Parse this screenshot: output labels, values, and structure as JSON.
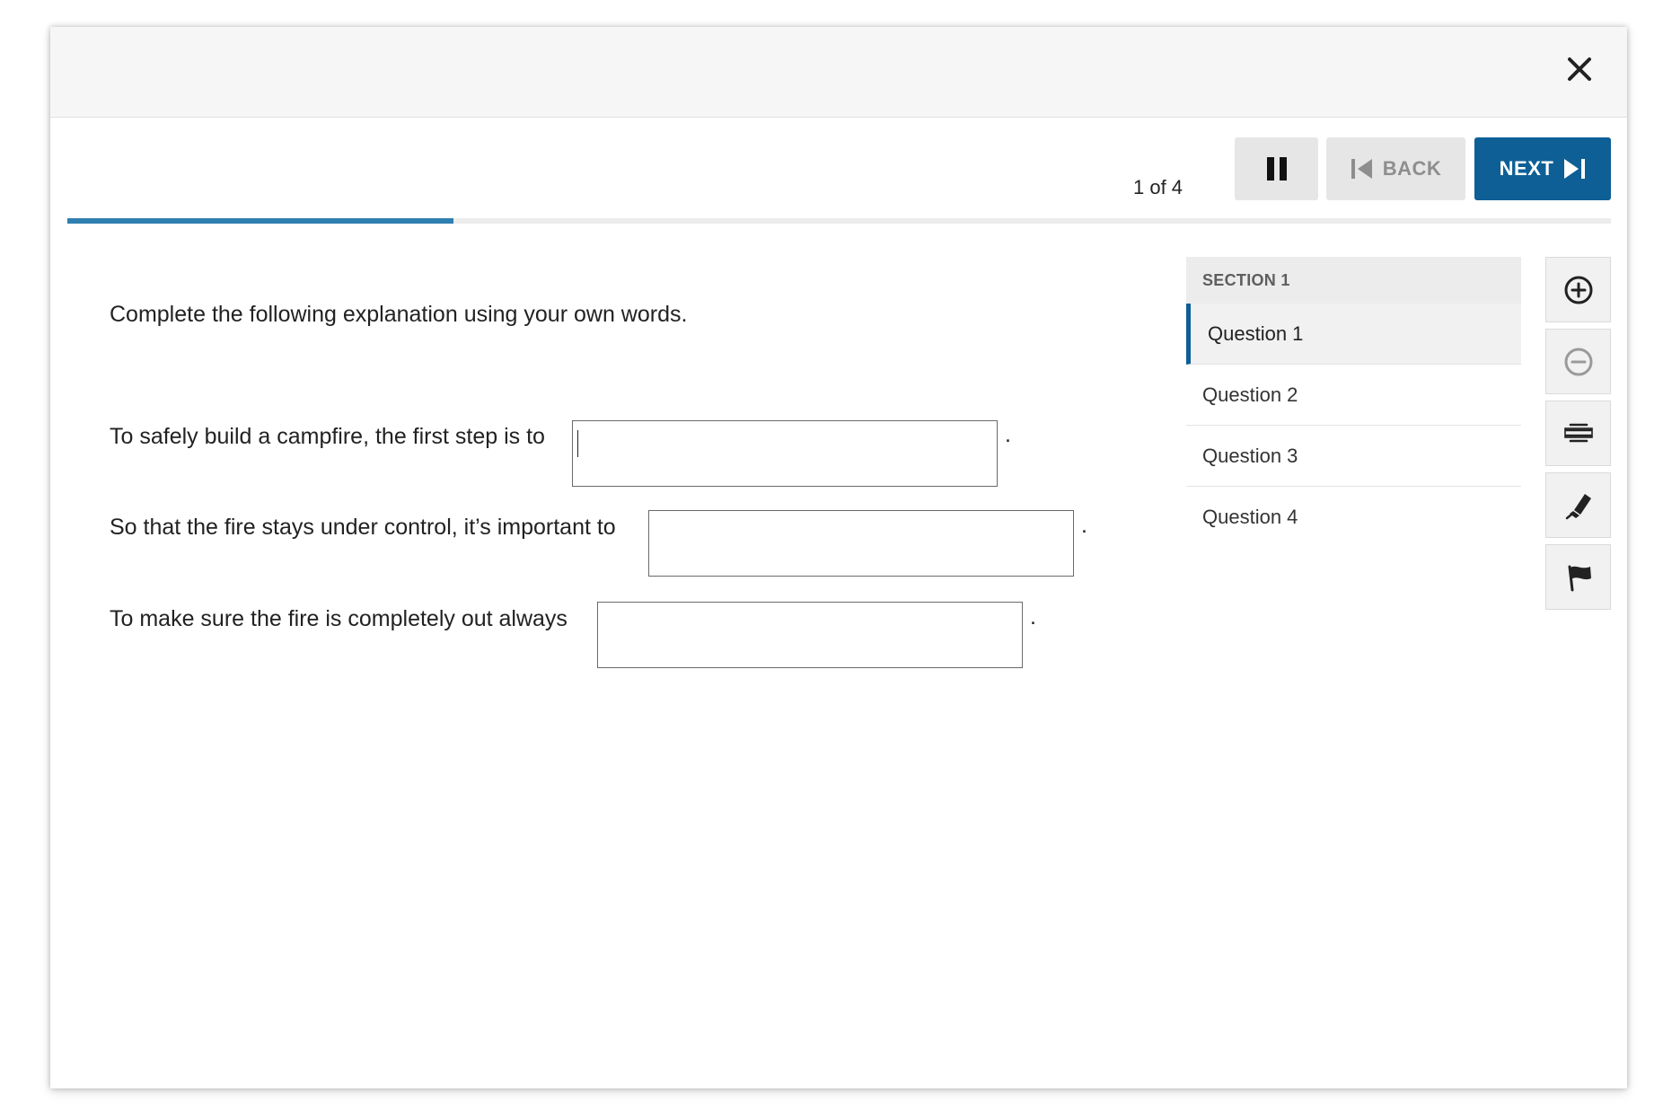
{
  "header": {
    "close_icon": "close-icon"
  },
  "toolbar": {
    "counter": "1 of 4",
    "pause_icon": "pause-icon",
    "back_label": "BACK",
    "next_label": "NEXT"
  },
  "progress": {
    "fraction": 0.25,
    "color": "#2f7fb0"
  },
  "question": {
    "prompt": "Complete the following explanation using your own words.",
    "sentences": [
      {
        "text": "To safely build a campfire, the first step is to",
        "value": "",
        "suffix": "."
      },
      {
        "text": "So that the fire stays under control, it’s important to",
        "value": "",
        "suffix": "."
      },
      {
        "text": "To make sure the fire is completely out always",
        "value": "",
        "suffix": "."
      }
    ]
  },
  "navigation": {
    "section_label": "SECTION 1",
    "items": [
      {
        "label": "Question 1",
        "active": true
      },
      {
        "label": "Question 2",
        "active": false
      },
      {
        "label": "Question 3",
        "active": false
      },
      {
        "label": "Question 4",
        "active": false
      }
    ]
  },
  "tools": [
    {
      "icon": "zoom-in-icon",
      "enabled": true
    },
    {
      "icon": "zoom-out-icon",
      "enabled": false
    },
    {
      "icon": "line-reader-icon",
      "enabled": true
    },
    {
      "icon": "highlighter-icon",
      "enabled": true
    },
    {
      "icon": "flag-icon",
      "enabled": true
    }
  ],
  "colors": {
    "accent": "#0d5f96",
    "button_gray": "#e6e6e6",
    "disabled_text": "#8e8e8e"
  }
}
